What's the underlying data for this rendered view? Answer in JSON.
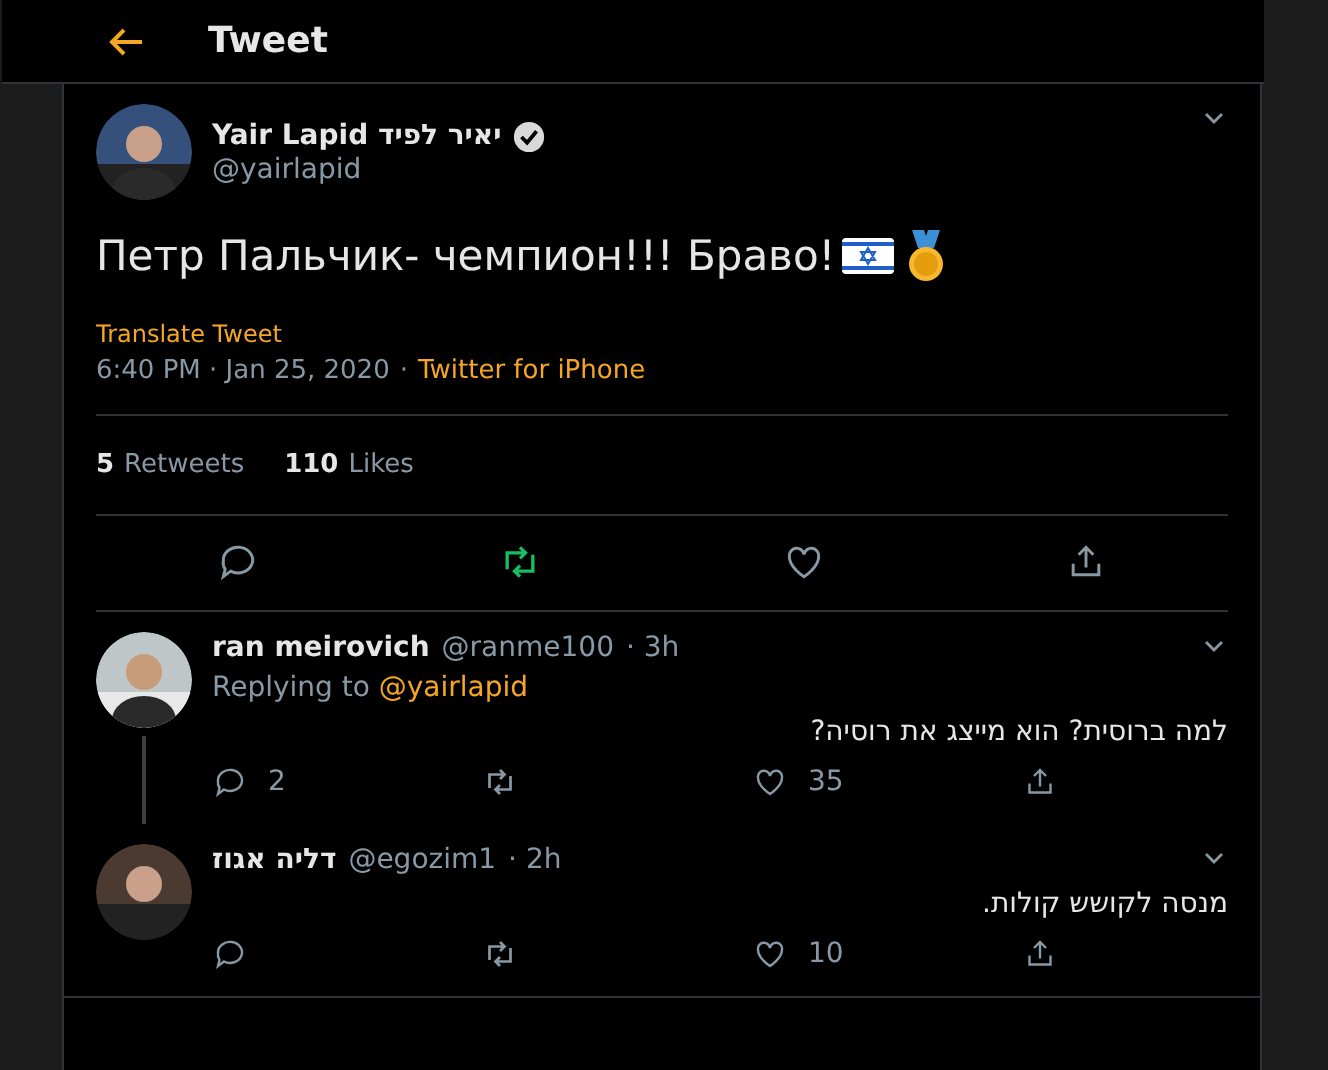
{
  "header": {
    "title": "Tweet"
  },
  "tweet": {
    "name": "Yair Lapid יאיר לפיד",
    "verified": true,
    "handle": "@yairlapid",
    "text": "Петр Пальчик- чемпион!!! Браво!",
    "translate": "Translate Tweet",
    "time": "6:40 PM · Jan 25, 2020",
    "separator": "·",
    "source": "Twitter for iPhone",
    "stats": [
      {
        "count": "5",
        "label": "Retweets"
      },
      {
        "count": "110",
        "label": "Likes"
      }
    ],
    "retweeted": true,
    "liked": false
  },
  "replies": [
    {
      "name": "ran meirovich",
      "handle": "@ranme100",
      "age": "· 3h",
      "replying_label": "Replying to",
      "replying_to": "@yairlapid",
      "text": "למה ברוסית? הוא מייצג את רוסיה?",
      "replies": "2",
      "likes": "35",
      "thread_continues": true
    },
    {
      "name": "דליה אגוז",
      "handle": "@egozim1",
      "age": "· 2h",
      "text": "מנסה לקושש קולות.",
      "likes": "10",
      "thread_continues": false
    }
  ]
}
